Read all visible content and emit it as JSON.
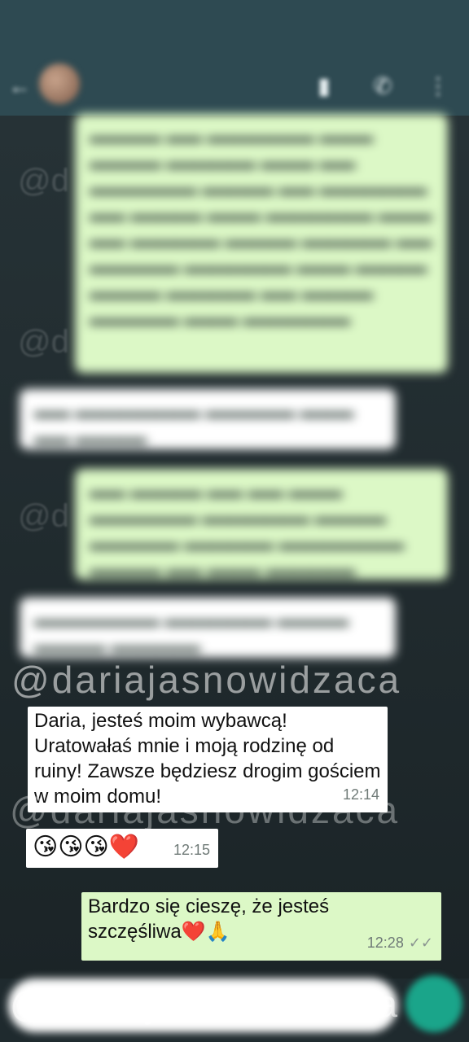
{
  "header": {
    "status_text": "",
    "status_right": "",
    "contact_name": ""
  },
  "icons": {
    "back": "arrow-left-icon",
    "video": "video-call-icon",
    "call": "phone-icon",
    "menu": "more-vert-icon",
    "mic": "mic-icon"
  },
  "messages": [
    {
      "direction": "incoming",
      "text": "Daria, jesteś moim wybawcą! Uratowałaś mnie i moją rodzinę od ruiny! Zawsze będziesz drogim gościem w moim domu!",
      "time": "12:14"
    },
    {
      "direction": "incoming",
      "text": "😘😘😘❤️",
      "time": "12:15"
    },
    {
      "direction": "outgoing",
      "text": "Bardzo się cieszę, że jesteś szczęśliwa❤️🙏",
      "time": "12:28",
      "status": "read"
    }
  ],
  "watermark": "@dariajasnowidzaca",
  "colors": {
    "header": "#2e4a52",
    "outgoing_bubble": "#dcf8c6",
    "incoming_bubble": "#ffffff",
    "fab": "#1aa58a"
  }
}
